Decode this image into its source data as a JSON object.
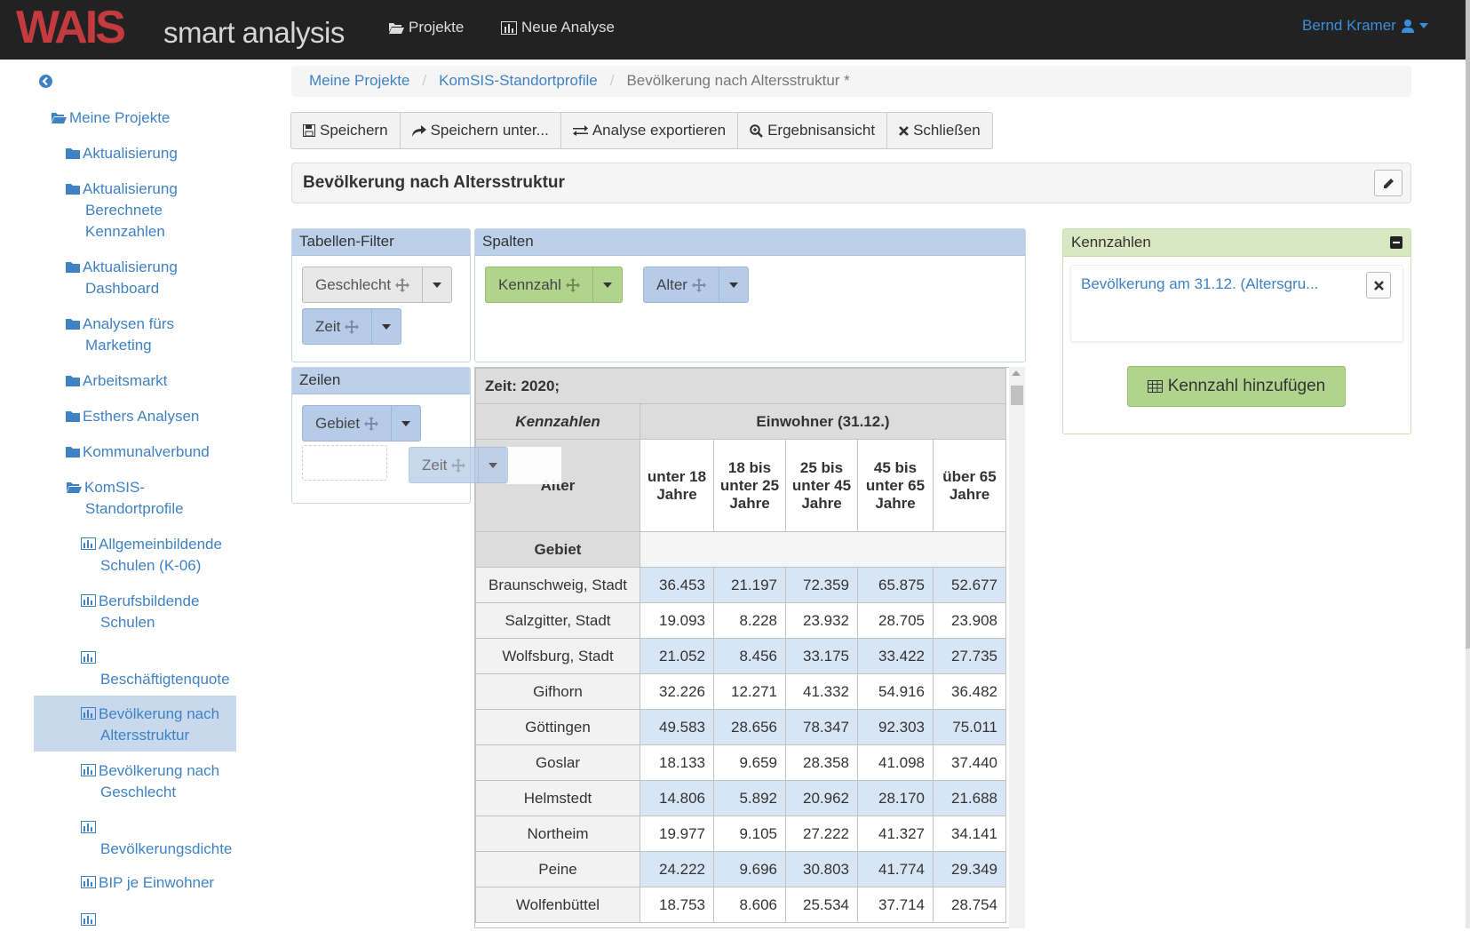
{
  "brand": {
    "logo": "WAIS",
    "subtitle": "smart analysis"
  },
  "nav": {
    "projects": "Projekte",
    "new_analysis": "Neue Analyse",
    "user": "Bernd Kramer"
  },
  "sidebar": {
    "root": "Meine Projekte",
    "items": [
      "Aktualisierung",
      "Aktualisierung Berechnete Kennzahlen",
      "Aktualisierung Dashboard",
      "Analysen fürs Marketing",
      "Arbeitsmarkt",
      "Esthers Analysen",
      "Kommunalverbund",
      "KomSIS-Standortprofile"
    ],
    "sub_items": [
      "Allgemeinbildende Schulen (K-06)",
      "Berufsbildende Schulen",
      "Beschäftigtenquote",
      "Bevölkerung nach Altersstruktur",
      "Bevölkerung nach Geschlecht",
      "Bevölkerungsdichte",
      "BIP je Einwohner"
    ]
  },
  "breadcrumb": [
    "Meine Projekte",
    "KomSIS-Standortprofile",
    "Bevölkerung nach Altersstruktur *"
  ],
  "toolbar": {
    "save": "Speichern",
    "save_as": "Speichern unter...",
    "export": "Analyse exportieren",
    "result_view": "Ergebnisansicht",
    "close": "Schließen"
  },
  "analysis_title": "Bevölkerung nach Altersstruktur",
  "filters": {
    "title": "Tabellen-Filter",
    "items": [
      "Geschlecht",
      "Zeit"
    ]
  },
  "columns": {
    "title": "Spalten",
    "items": [
      "Kennzahl",
      "Alter"
    ]
  },
  "rows": {
    "title": "Zeilen",
    "items": [
      "Gebiet"
    ],
    "dragging": "Zeit"
  },
  "table": {
    "zeit_label": "Zeit: 2020;",
    "kennzahlen_header": "Kennzahlen",
    "measure_header": "Einwohner (31.12.)",
    "alter_header": "Alter",
    "gebiet_header": "Gebiet",
    "age_columns": [
      "unter 18 Jahre",
      "18 bis unter 25 Jahre",
      "25 bis unter 45 Jahre",
      "45 bis unter 65 Jahre",
      "über 65 Jahre"
    ],
    "rows": [
      {
        "gebiet": "Braunschweig, Stadt",
        "values": [
          "36.453",
          "21.197",
          "72.359",
          "65.875",
          "52.677"
        ]
      },
      {
        "gebiet": "Salzgitter, Stadt",
        "values": [
          "19.093",
          "8.228",
          "23.932",
          "28.705",
          "23.908"
        ]
      },
      {
        "gebiet": "Wolfsburg, Stadt",
        "values": [
          "21.052",
          "8.456",
          "33.175",
          "33.422",
          "27.735"
        ]
      },
      {
        "gebiet": "Gifhorn",
        "values": [
          "32.226",
          "12.271",
          "41.332",
          "54.916",
          "36.482"
        ]
      },
      {
        "gebiet": "Göttingen",
        "values": [
          "49.583",
          "28.656",
          "78.347",
          "92.303",
          "75.011"
        ]
      },
      {
        "gebiet": "Goslar",
        "values": [
          "18.133",
          "9.659",
          "28.358",
          "41.098",
          "37.440"
        ]
      },
      {
        "gebiet": "Helmstedt",
        "values": [
          "14.806",
          "5.892",
          "20.962",
          "28.170",
          "21.688"
        ]
      },
      {
        "gebiet": "Northeim",
        "values": [
          "19.977",
          "9.105",
          "27.222",
          "41.327",
          "34.141"
        ]
      },
      {
        "gebiet": "Peine",
        "values": [
          "24.222",
          "9.696",
          "30.803",
          "41.774",
          "29.349"
        ]
      },
      {
        "gebiet": "Wolfenbüttel",
        "values": [
          "18.753",
          "8.606",
          "25.534",
          "37.714",
          "28.754"
        ]
      }
    ]
  },
  "kennzahlen": {
    "title": "Kennzahlen",
    "item": "Bevölkerung am 31.12. (Altersgru...",
    "add_button": "Kennzahl hinzufügen"
  },
  "colors": {
    "topbar": "#222222",
    "link": "#3f82c4",
    "logo": "#c43b3f",
    "green": "#b0d48e",
    "blue": "#b5cbe8"
  }
}
